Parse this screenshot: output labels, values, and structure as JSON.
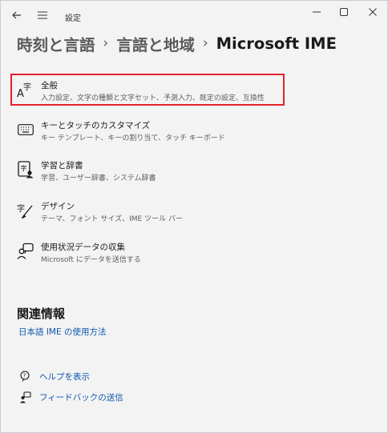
{
  "titlebar": {
    "app_title": "設定"
  },
  "breadcrumb": {
    "items": [
      "時刻と言語",
      "言語と地域",
      "Microsoft IME"
    ],
    "separator": "›"
  },
  "items": [
    {
      "icon": "ime-character-settings-icon",
      "title": "全般",
      "subtitle": "入力設定、文字の種類と文字セット、予測入力、既定の設定、互換性"
    },
    {
      "icon": "keyboard-icon",
      "title": "キーとタッチのカスタマイズ",
      "subtitle": "キー テンプレート、キーの割り当て、タッチ キーボード"
    },
    {
      "icon": "dictionary-icon",
      "title": "学習と辞書",
      "subtitle": "学習、ユーザー辞書、システム辞書"
    },
    {
      "icon": "design-brush-icon",
      "title": "デザイン",
      "subtitle": "テーマ、フォント サイズ、IME ツール バー"
    },
    {
      "icon": "data-collection-icon",
      "title": "使用状況データの収集",
      "subtitle": "Microsoft にデータを送信する"
    }
  ],
  "related": {
    "title": "関連情報",
    "link": "日本語 IME の使用方法"
  },
  "help_links": [
    {
      "icon": "help-icon",
      "label": "ヘルプを表示"
    },
    {
      "icon": "feedback-icon",
      "label": "フィードバックの送信"
    }
  ],
  "colors": {
    "accent_link": "#0d56b0",
    "highlight_border": "#e3212b",
    "background": "#f3f3f3"
  }
}
